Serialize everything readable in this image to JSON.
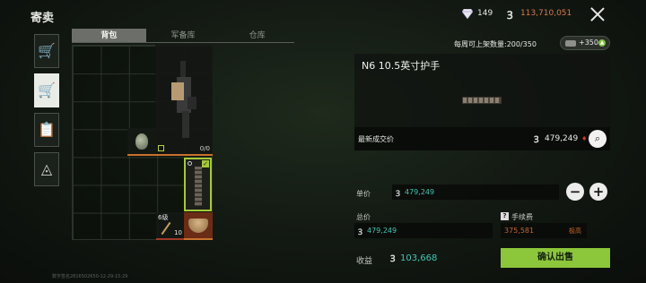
{
  "page": {
    "title": "寄卖",
    "watermark": "数字签名2816502650-12-29-15:29"
  },
  "status": {
    "gem_icon": "diamond-icon",
    "gems": "149",
    "coin_icon": "coin-icon",
    "coins": "113,710,051",
    "coin_symbol": "Ꝫ"
  },
  "side_nav": [
    {
      "name": "buy",
      "icon": "cart-icon",
      "glyph": "🛒",
      "active": false
    },
    {
      "name": "sell",
      "icon": "cart-sell-icon",
      "glyph": "🛒",
      "active": true
    },
    {
      "name": "orders",
      "icon": "clipboard-icon",
      "glyph": "📋",
      "active": false
    },
    {
      "name": "rank",
      "icon": "triangle-eye-icon",
      "glyph": "◬",
      "active": false
    }
  ],
  "tabs": [
    {
      "label": "背包",
      "active": true
    },
    {
      "label": "军备库",
      "active": false
    },
    {
      "label": "仓库",
      "active": false
    }
  ],
  "inventory": {
    "gun_count": "0/0",
    "level_label": "6级",
    "level_count": "10"
  },
  "right": {
    "weekly_limit": "每周可上架数量:200/350",
    "plus_label": "+350",
    "item_name": "N6 10.5英寸护手",
    "latest_price_label": "最新成交价",
    "latest_price": "479,249",
    "latest_price_arrow": "♦",
    "unit_price_label": "单价",
    "unit_price": "479,249",
    "total_label": "总价",
    "total_price": "479,249",
    "fee_label": "手续费",
    "fee_value": "375,581",
    "fee_tag": "极高",
    "profit_label": "收益",
    "profit_value": "103,668",
    "confirm_label": "确认出售",
    "minus": "−",
    "plus": "+",
    "help": "?"
  }
}
